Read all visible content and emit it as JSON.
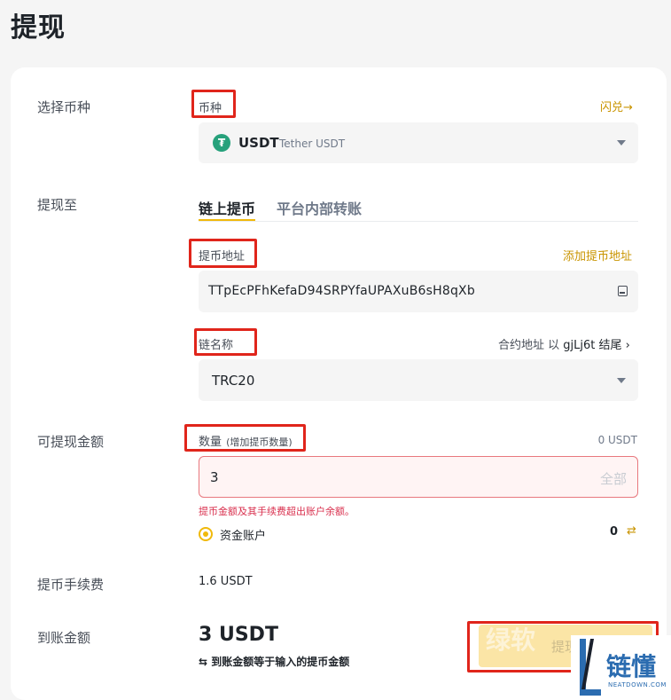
{
  "page": {
    "title": "提现"
  },
  "coin": {
    "row_label": "选择币种",
    "field_label": "币种",
    "flash_link": "闪兑",
    "flash_arrow": "→",
    "symbol": "USDT",
    "name": "Tether USDT"
  },
  "withdraw_to": {
    "row_label": "提现至",
    "tabs": [
      "链上提币",
      "平台内部转账"
    ],
    "active_tab": 0
  },
  "address": {
    "label": "提币地址",
    "add_link": "添加提币地址",
    "value": "TTpEcPFhKefaD94SRPYfaUPAXuB6sH8qXb",
    "book_icon": "address-book-icon"
  },
  "network": {
    "label": "链名称",
    "contract_prefix": "合约地址 以",
    "contract_suffix": "gjLj6t",
    "contract_end": "结尾",
    "contract_arrow": "›",
    "value": "TRC20"
  },
  "amount": {
    "row_label": "可提现金额",
    "label": "数量",
    "label_hint": "(增加提币数量)",
    "available": "0 USDT",
    "value": "3",
    "all_button": "全部",
    "error": "提币金额及其手续费超出账户余额。",
    "account_label": "资金账户",
    "account_balance": "0",
    "transfer_icon": "transfer-icon"
  },
  "fee": {
    "row_label": "提币手续费",
    "value": "1.6 USDT"
  },
  "receive": {
    "row_label": "到账金额",
    "value": "3 USDT",
    "note_icon": "⇆",
    "note": "到账金额等于输入的提币金额",
    "button": "提现"
  },
  "watermark": {
    "text1": "绿软",
    "text2": "链懂",
    "sub": "NEATDOWN.COM"
  },
  "colors": {
    "accent": "#f0b90b",
    "link": "#c99400",
    "error": "#d9304e",
    "highlight_box": "#e0251b",
    "usdt_green": "#26a17b"
  }
}
